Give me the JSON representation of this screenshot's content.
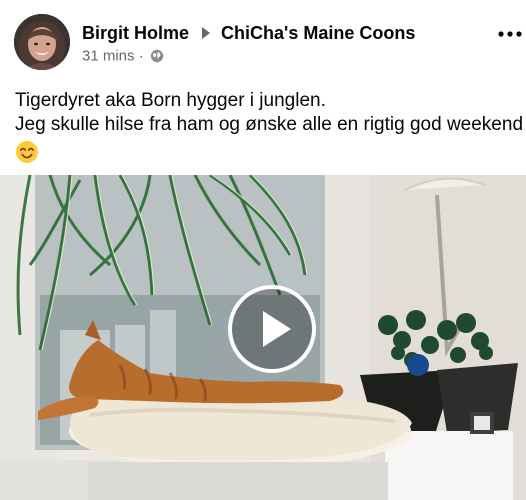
{
  "post": {
    "author": "Birgit Holme",
    "group": "ChiCha's Maine Coons",
    "time": "31 mins",
    "separator": "·",
    "audience_icon": "globe-icon",
    "more_icon": "more-options-icon",
    "text_lines": [
      "Tigerdyret aka Born hygger i junglen.",
      "Jeg skulle hilse fra ham og ønske alle en rigtig god weekend"
    ],
    "emoji": "smiling-face-emoji"
  },
  "video": {
    "play_icon": "play-icon"
  },
  "colors": {
    "text": "#050505",
    "meta": "#65676b"
  }
}
